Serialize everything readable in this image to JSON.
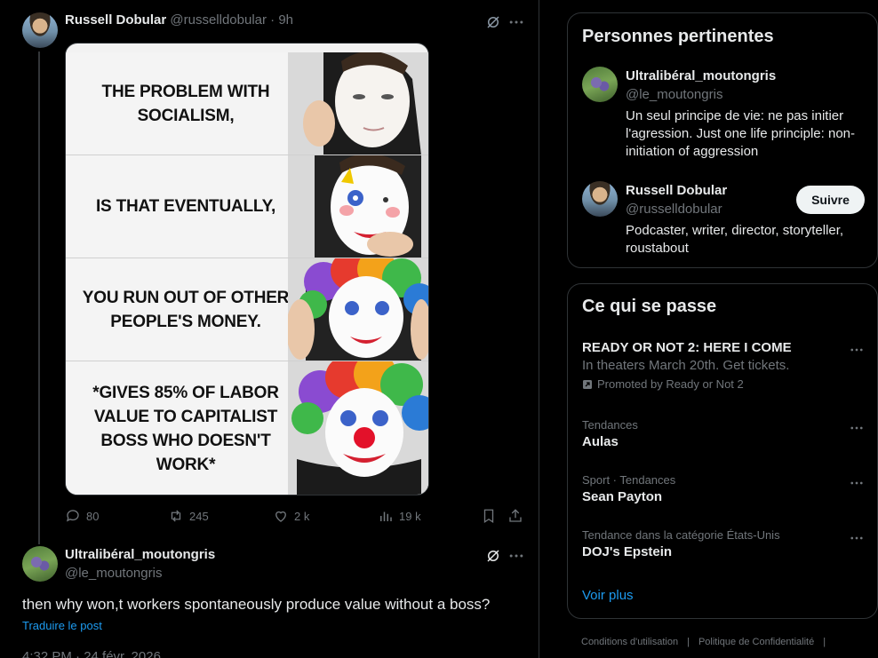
{
  "original_post": {
    "author_name": "Russell Dobular",
    "author_handle": "@russelldobular",
    "time_ago": "· 9h",
    "meme_panels": [
      "THE PROBLEM WITH SOCIALISM,",
      "IS THAT EVENTUALLY,",
      "YOU RUN OUT OF OTHER PEOPLE'S MONEY.",
      "*GIVES 85% OF LABOR VALUE TO CAPITALIST BOSS WHO DOESN'T WORK*"
    ],
    "replies": "80",
    "reposts": "245",
    "likes": "2 k",
    "views": "19 k"
  },
  "reply_post": {
    "author_name": "Ultralibéral_moutongris",
    "author_handle": "@le_moutongris",
    "text": "then why won,t workers spontaneously produce value without a boss?",
    "translate_label": "Traduire le post",
    "timestamp": "4:32 PM · 24 févr. 2026"
  },
  "relevant_people": {
    "title": "Personnes pertinentes",
    "people": [
      {
        "name": "Ultralibéral_moutongris",
        "handle": "@le_moutongris",
        "bio": "Un seul principe de vie: ne pas initier l'agression. Just one life principle: non-initiation of aggression"
      },
      {
        "name": "Russell Dobular",
        "handle": "@russelldobular",
        "bio": "Podcaster, writer, director, storyteller, roustabout",
        "follow_label": "Suivre"
      }
    ]
  },
  "trends": {
    "title": "Ce qui se passe",
    "items": [
      {
        "title": "READY OR NOT 2: HERE I COME",
        "subtitle": "In theaters March 20th. Get tickets.",
        "promoted": "Promoted by Ready or Not 2"
      },
      {
        "context": "Tendances",
        "title": "Aulas"
      },
      {
        "context": "Sport · Tendances",
        "title": "Sean Payton"
      },
      {
        "context": "Tendance dans la catégorie États-Unis",
        "title": "DOJ's Epstein"
      }
    ],
    "show_more": "Voir plus"
  },
  "footer": {
    "terms": "Conditions d'utilisation",
    "privacy": "Politique de Confidentialité"
  },
  "colors": {
    "background": "#000000",
    "text": "#e7e9ea",
    "muted": "#71767b",
    "accent": "#1d9bf0",
    "border": "#2f3336"
  }
}
